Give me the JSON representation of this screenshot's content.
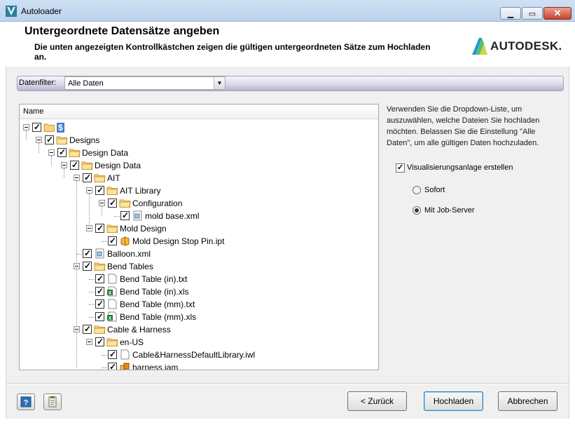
{
  "window": {
    "title": "Autoloader",
    "minimize": "▁",
    "maximize": "▭",
    "close": "✕",
    "app_icon": "autoloader-app-icon"
  },
  "header": {
    "title": "Untergeordnete Datensätze angeben",
    "description": "Die unten angezeigten Kontrollkästchen zeigen die gültigen untergeordneten Sätze zum Hochladen an.",
    "logo_text": "AUTODESK."
  },
  "filter": {
    "label": "Datenfilter:",
    "selected": "Alle Daten"
  },
  "tree": {
    "column_header": "Name",
    "rows": [
      {
        "label": "$"
      },
      {
        "label": "Designs"
      },
      {
        "label": "Design Data"
      },
      {
        "label": "Design Data"
      },
      {
        "label": "AIT"
      },
      {
        "label": "AIT Library"
      },
      {
        "label": "Configuration"
      },
      {
        "label": "mold base.xml"
      },
      {
        "label": "Mold Design"
      },
      {
        "label": "Mold Design Stop Pin.ipt"
      },
      {
        "label": "Balloon.xml"
      },
      {
        "label": "Bend Tables"
      },
      {
        "label": "Bend Table (in).txt"
      },
      {
        "label": "Bend Table (in).xls"
      },
      {
        "label": "Bend Table (mm).txt"
      },
      {
        "label": "Bend Table (mm).xls"
      },
      {
        "label": "Cable & Harness"
      },
      {
        "label": "en-US"
      },
      {
        "label": "Cable&HarnessDefaultLibrary.iwl"
      },
      {
        "label": "harness.iam"
      }
    ]
  },
  "info_text": "Verwenden Sie die Dropdown-Liste, um auszuwählen, welche Dateien Sie hochladen möchten. Belassen Sie die Einstellung \"Alle Daten\", um alle gültigen Daten hochzuladen.",
  "options": {
    "visualization_label": "Visualisierungsanlage erstellen",
    "visualization_checked": true,
    "radio_now": "Sofort",
    "radio_job_server": "Mit Job-Server",
    "selected_radio": "Mit Job-Server"
  },
  "buttons": {
    "back": "< Zurück",
    "upload": "Hochladen",
    "cancel": "Abbrechen"
  }
}
